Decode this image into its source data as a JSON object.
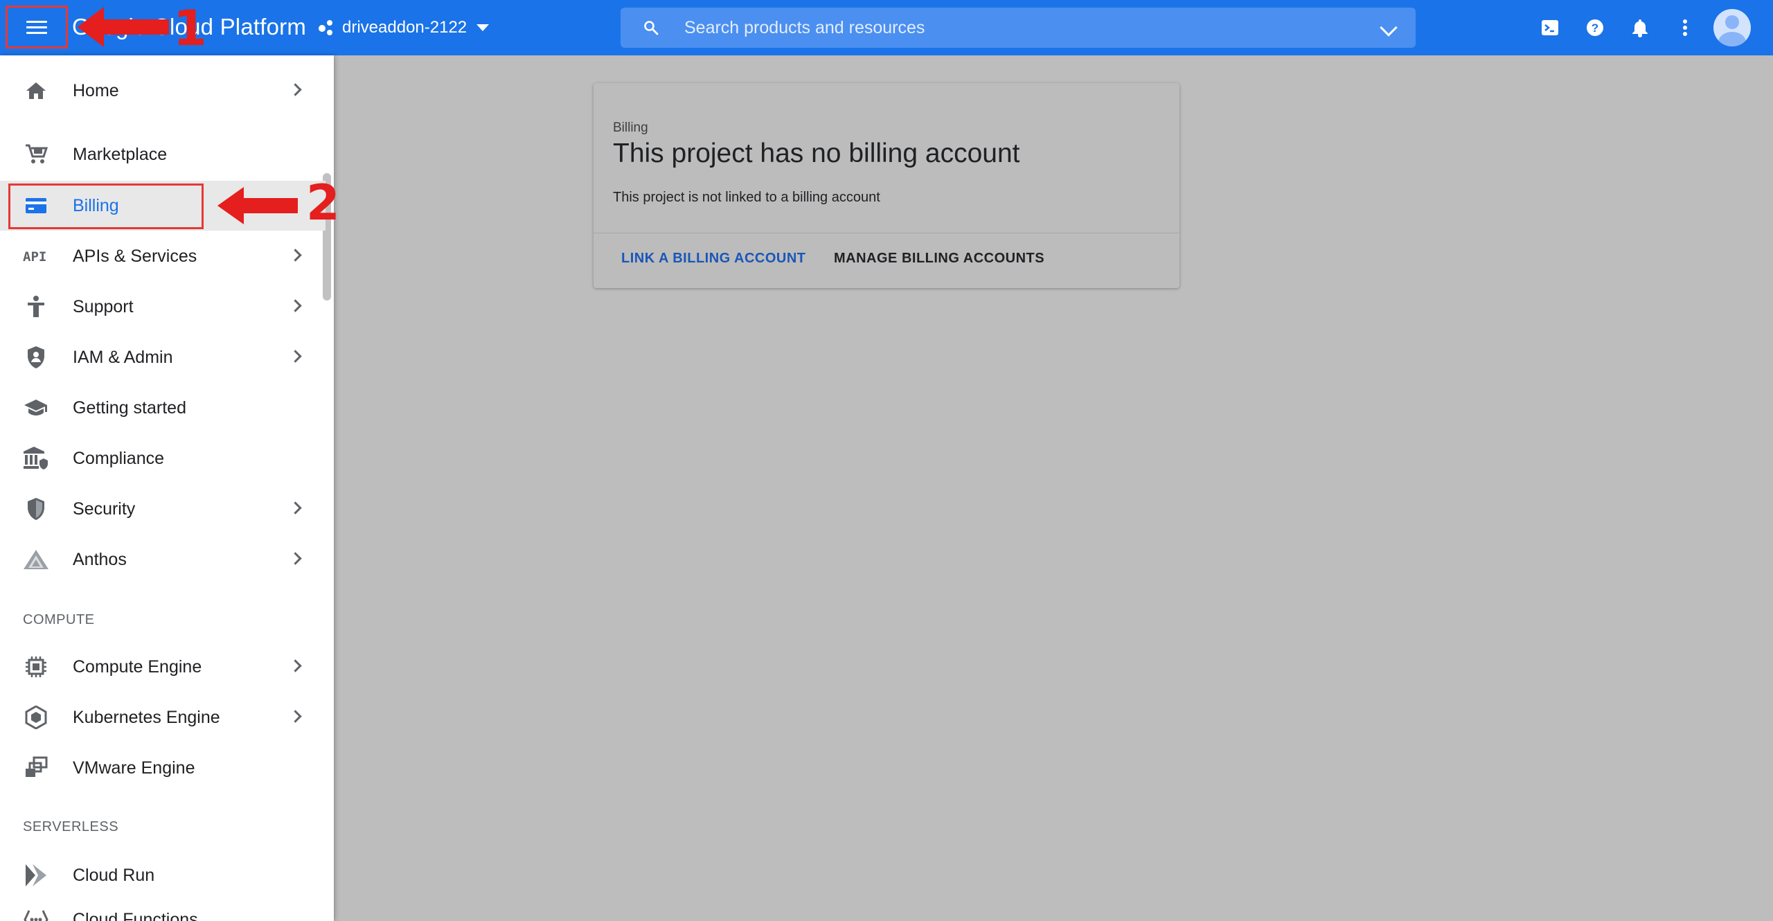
{
  "header": {
    "title": "Google Cloud Platform",
    "project": "driveaddon-2122",
    "search_placeholder": "Search products and resources"
  },
  "sidebar": {
    "items": [
      {
        "label": "Home",
        "icon": "home-icon",
        "has_arrow": true
      },
      {
        "label": "Marketplace",
        "icon": "cart-icon",
        "has_arrow": false
      },
      {
        "label": "Billing",
        "icon": "billing-icon",
        "has_arrow": false,
        "active": true
      },
      {
        "label": "APIs & Services",
        "icon": "api-icon",
        "has_arrow": true
      },
      {
        "label": "Support",
        "icon": "support-icon",
        "has_arrow": true
      },
      {
        "label": "IAM & Admin",
        "icon": "shield-person-icon",
        "has_arrow": true
      },
      {
        "label": "Getting started",
        "icon": "graduation-cap-icon",
        "has_arrow": false
      },
      {
        "label": "Compliance",
        "icon": "building-icon",
        "has_arrow": false
      },
      {
        "label": "Security",
        "icon": "security-shield-icon",
        "has_arrow": true
      },
      {
        "label": "Anthos",
        "icon": "anthos-icon",
        "has_arrow": true
      }
    ],
    "compute_header": "COMPUTE",
    "compute_items": [
      {
        "label": "Compute Engine",
        "icon": "chip-icon",
        "has_arrow": true
      },
      {
        "label": "Kubernetes Engine",
        "icon": "kubernetes-icon",
        "has_arrow": true
      },
      {
        "label": "VMware Engine",
        "icon": "vmware-icon",
        "has_arrow": false
      }
    ],
    "serverless_header": "SERVERLESS",
    "serverless_items": [
      {
        "label": "Cloud Run",
        "icon": "cloud-run-icon",
        "has_arrow": false
      },
      {
        "label": "Cloud Functions",
        "icon": "functions-icon",
        "has_arrow": false
      }
    ]
  },
  "card": {
    "breadcrumb": "Billing",
    "title": "This project has no billing account",
    "description": "This project is not linked to a billing account",
    "link_button": "LINK A BILLING ACCOUNT",
    "manage_button": "MANAGE BILLING ACCOUNTS"
  },
  "annotations": {
    "step1": "1",
    "step2": "2"
  },
  "colors": {
    "header_blue": "#1a73e8",
    "annotation_red": "#e51e1e",
    "overlay_gray": "#bdbdbd"
  }
}
